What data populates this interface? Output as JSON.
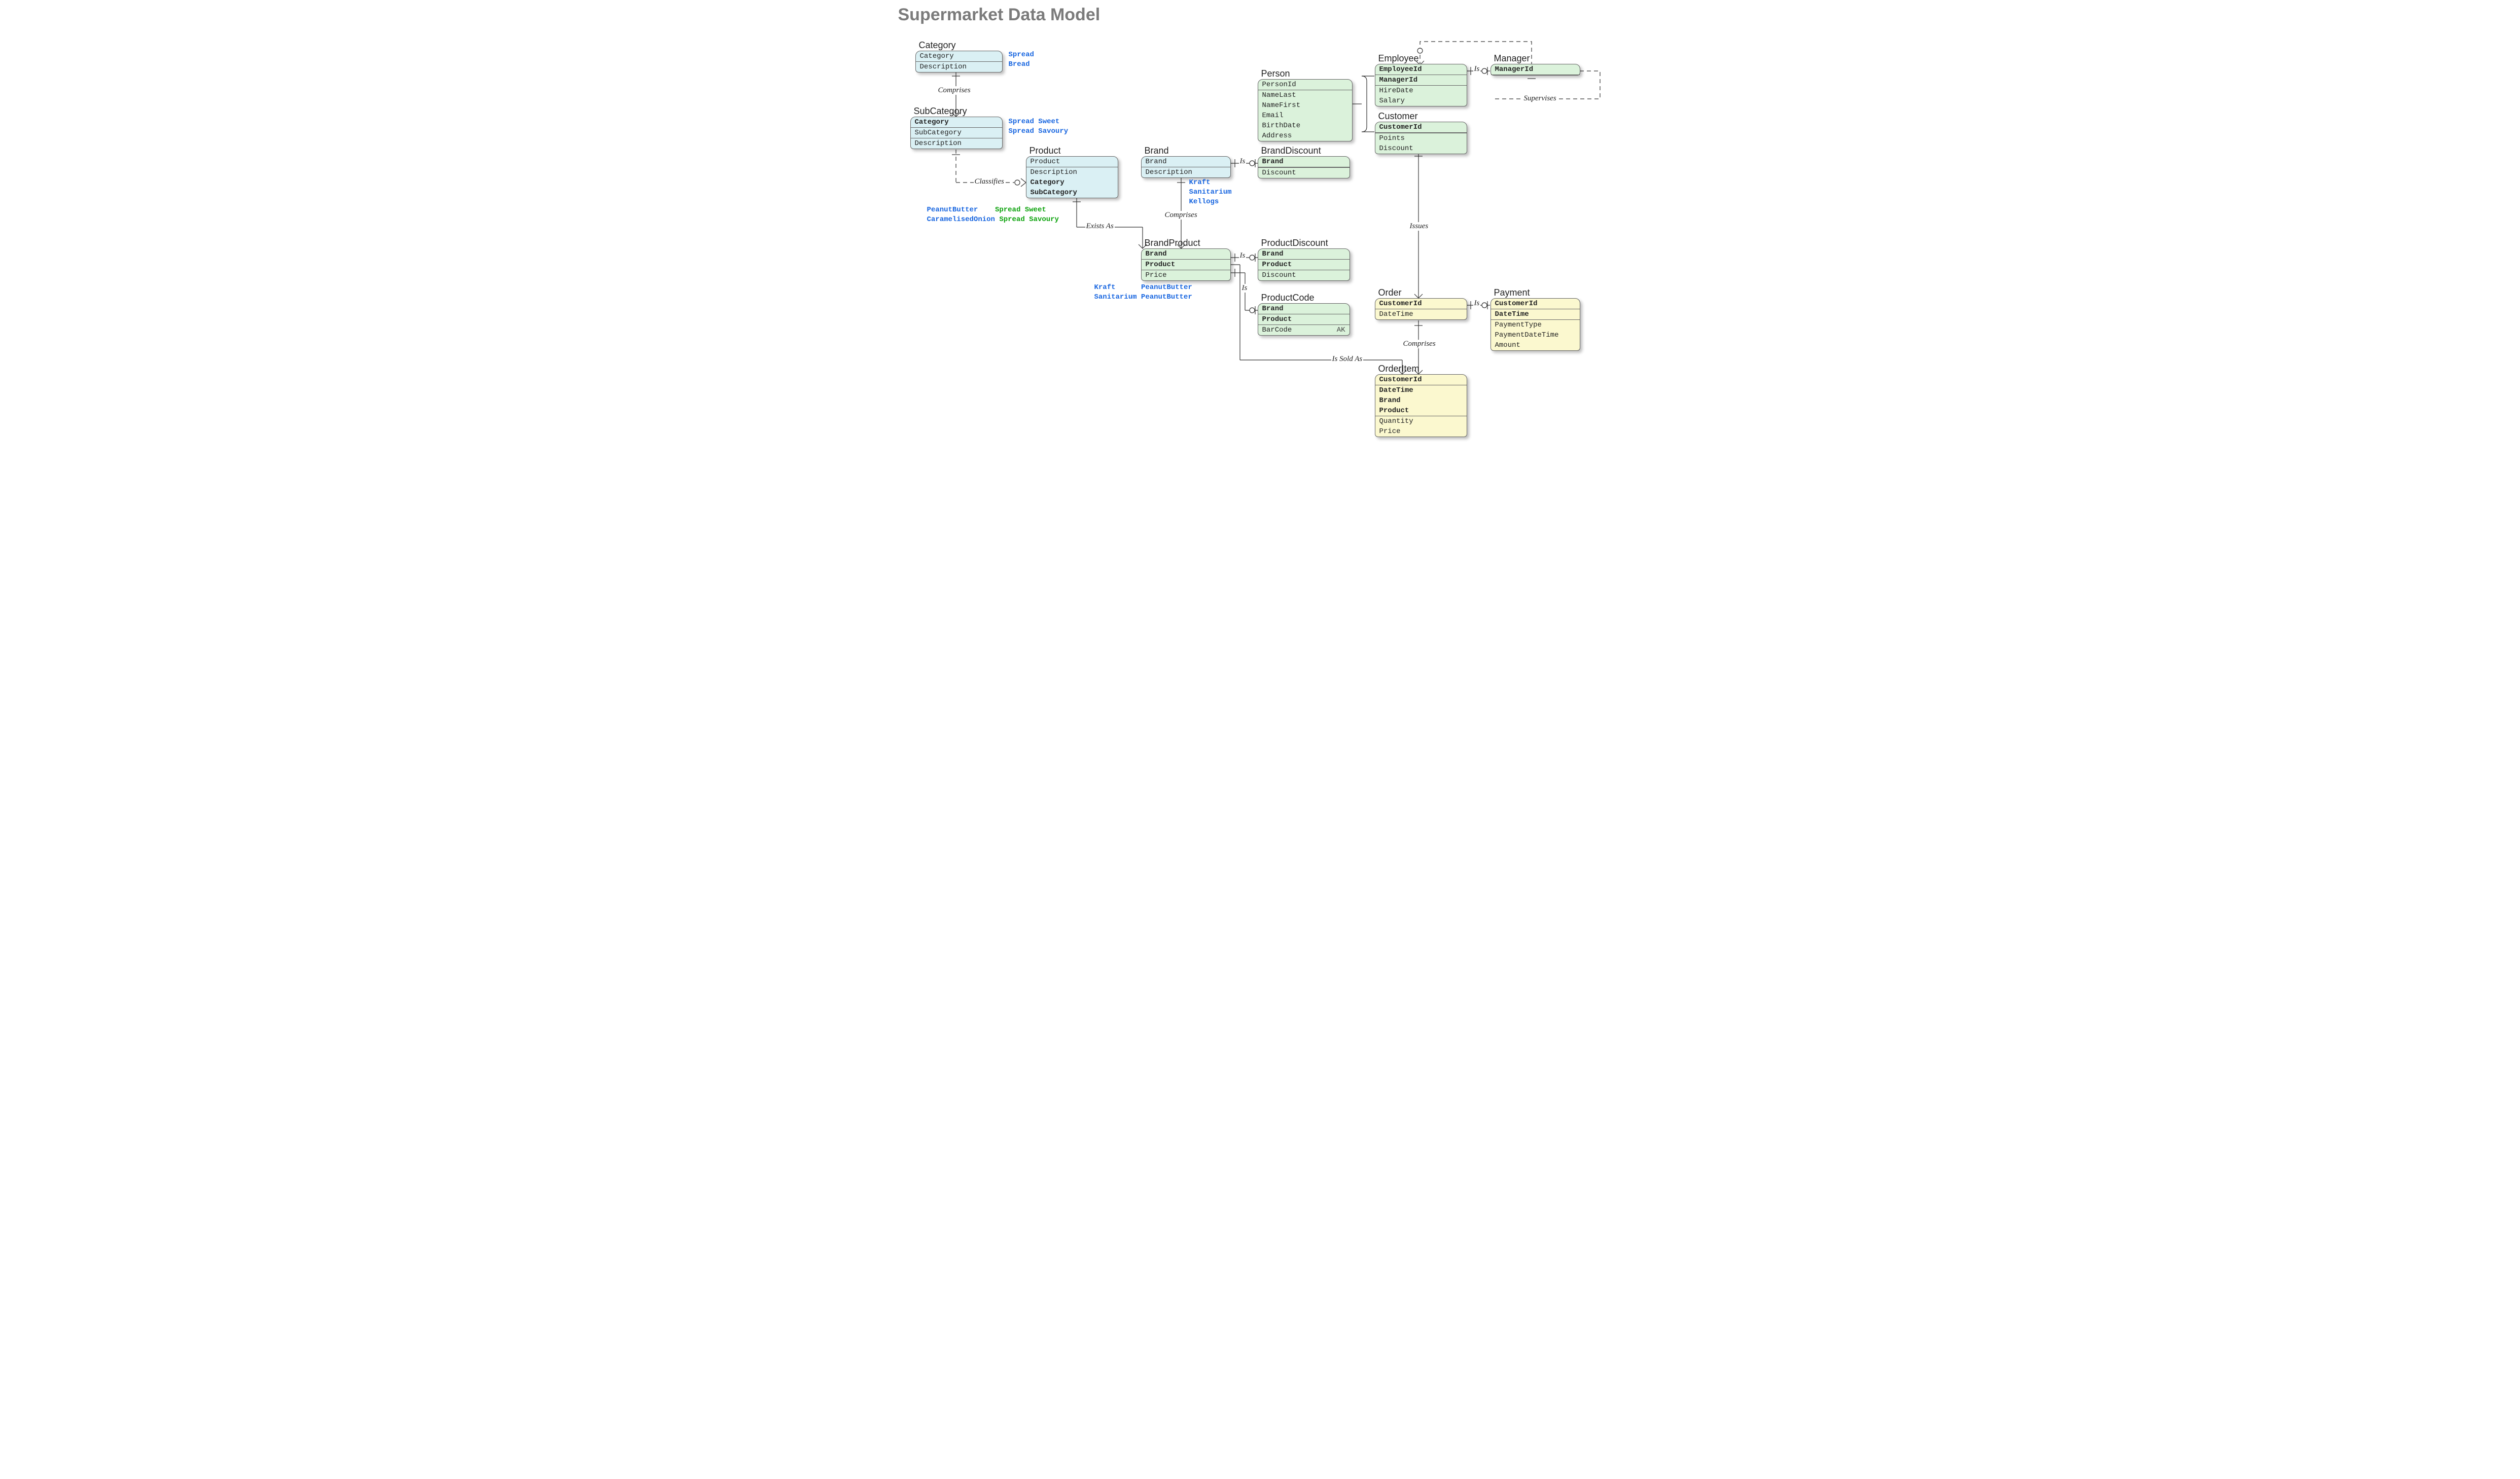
{
  "title": "Supermarket Data Model",
  "palette": {
    "blue": "#daf0f4",
    "green": "#dbf2db",
    "yellow": "#fbf8cf",
    "label": "#1866e0"
  },
  "entities": {
    "category": {
      "name": "Category",
      "fields": [
        [
          "Category",
          false,
          "hdr"
        ],
        [
          "Description",
          false,
          ""
        ]
      ]
    },
    "subcategory": {
      "name": "SubCategory",
      "fields": [
        [
          "Category",
          true,
          "hdr"
        ],
        [
          "SubCategory",
          false,
          ""
        ],
        [
          "Description",
          false,
          "sep"
        ]
      ]
    },
    "product": {
      "name": "Product",
      "fields": [
        [
          "Product",
          false,
          "hdr"
        ],
        [
          "Description",
          false,
          ""
        ],
        [
          "Category",
          true,
          ""
        ],
        [
          "SubCategory",
          true,
          ""
        ]
      ]
    },
    "brand": {
      "name": "Brand",
      "fields": [
        [
          "Brand",
          false,
          "hdr"
        ],
        [
          "Description",
          false,
          ""
        ]
      ]
    },
    "brandproduct": {
      "name": "BrandProduct",
      "fields": [
        [
          "Brand",
          true,
          "hdr"
        ],
        [
          "Product",
          true,
          ""
        ],
        [
          "Price",
          false,
          "sep"
        ]
      ]
    },
    "branddiscount": {
      "name": "BrandDiscount",
      "fields": [
        [
          "Brand",
          true,
          "hdr"
        ],
        [
          "Discount",
          false,
          "sep"
        ]
      ]
    },
    "productdiscount": {
      "name": "ProductDiscount",
      "fields": [
        [
          "Brand",
          true,
          "hdr"
        ],
        [
          "Product",
          true,
          ""
        ],
        [
          "Discount",
          false,
          "sep"
        ]
      ]
    },
    "productcode": {
      "name": "ProductCode",
      "fields": [
        [
          "Brand",
          true,
          "hdr"
        ],
        [
          "Product",
          true,
          ""
        ],
        [
          "BarCode",
          false,
          "sep",
          "AK"
        ]
      ]
    },
    "person": {
      "name": "Person",
      "fields": [
        [
          "PersonId",
          false,
          "hdr"
        ],
        [
          "NameLast",
          false,
          ""
        ],
        [
          "NameFirst",
          false,
          ""
        ],
        [
          "Email",
          false,
          ""
        ],
        [
          "BirthDate",
          false,
          ""
        ],
        [
          "Address",
          false,
          ""
        ]
      ]
    },
    "employee": {
      "name": "Employee",
      "fields": [
        [
          "EmployeeId",
          true,
          "hdr"
        ],
        [
          "ManagerId",
          true,
          ""
        ],
        [
          "HireDate",
          false,
          "sep"
        ],
        [
          "Salary",
          false,
          ""
        ]
      ]
    },
    "manager": {
      "name": "Manager",
      "fields": [
        [
          "ManagerId",
          true,
          "hdr"
        ]
      ]
    },
    "customer": {
      "name": "Customer",
      "fields": [
        [
          "CustomerId",
          true,
          "hdr"
        ],
        [
          "Points",
          false,
          "sep"
        ],
        [
          "Discount",
          false,
          ""
        ]
      ]
    },
    "order": {
      "name": "Order",
      "fields": [
        [
          "CustomerId",
          true,
          "hdr"
        ],
        [
          "DateTime",
          false,
          ""
        ]
      ]
    },
    "payment": {
      "name": "Payment",
      "fields": [
        [
          "CustomerId",
          true,
          "hdr"
        ],
        [
          "DateTime",
          true,
          ""
        ],
        [
          "PaymentType",
          false,
          "sep"
        ],
        [
          "PaymentDateTime",
          false,
          ""
        ],
        [
          "Amount",
          false,
          ""
        ]
      ]
    },
    "orderitem": {
      "name": "OrderItem",
      "fields": [
        [
          "CustomerId",
          true,
          "hdr"
        ],
        [
          "DateTime",
          true,
          ""
        ],
        [
          "Brand",
          true,
          ""
        ],
        [
          "Product",
          true,
          ""
        ],
        [
          "Quantity",
          false,
          "sep"
        ],
        [
          "Price",
          false,
          ""
        ]
      ]
    }
  },
  "relationships": {
    "comprises1": "Comprises",
    "classifies": "Classifies",
    "existsas": "Exists As",
    "comprises2": "Comprises",
    "is1": "Is",
    "is2": "Is",
    "is3": "Is",
    "is4": "Is",
    "is5": "Is",
    "supervises": "Supervises",
    "issues": "Issues",
    "comprises3": "Comprises",
    "issoldas": "Is Sold As"
  },
  "examples": {
    "category": "Spread\nBread",
    "subcategory": "Spread Sweet\nSpread Savoury",
    "product_a": "PeanutButter",
    "product_b": "CaramelisedOnion",
    "product_c": "Spread Sweet",
    "product_d": "Spread Savoury",
    "brand": "Kraft\nSanitarium\nKellogs",
    "bp1a": "Kraft",
    "bp1b": "PeanutButter",
    "bp2a": "Sanitarium",
    "bp2b": "PeanutButter"
  }
}
